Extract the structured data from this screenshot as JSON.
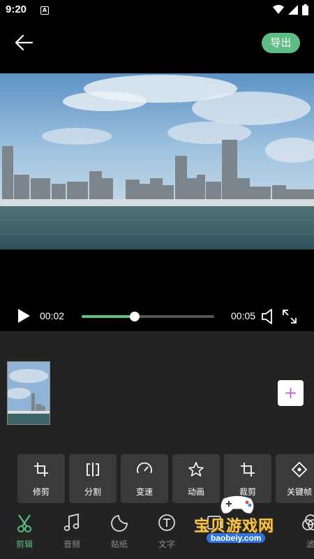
{
  "status_bar": {
    "time": "9:20",
    "notification_icon": "A",
    "icons": [
      "wifi-icon",
      "signal-icon",
      "battery-icon"
    ]
  },
  "header": {
    "back_icon": "arrow-left-icon",
    "export_label": "导出"
  },
  "player": {
    "current_time": "00:02",
    "total_time": "00:05",
    "progress_fraction": 0.4,
    "accent_color": "#5dbd84"
  },
  "tools": [
    {
      "label": "修剪",
      "icon": "trim-icon"
    },
    {
      "label": "分割",
      "icon": "split-icon"
    },
    {
      "label": "变速",
      "icon": "speed-gauge-icon"
    },
    {
      "label": "动画",
      "icon": "star-icon"
    },
    {
      "label": "裁剪",
      "icon": "crop-icon"
    },
    {
      "label": "关键帧",
      "icon": "keyframe-diamond-icon"
    }
  ],
  "nav": [
    {
      "label": "剪辑",
      "icon": "scissors-icon",
      "active": true
    },
    {
      "label": "音频",
      "icon": "music-note-icon",
      "active": false
    },
    {
      "label": "贴纸",
      "icon": "sticker-icon",
      "active": false
    },
    {
      "label": "文字",
      "icon": "text-icon",
      "active": false
    },
    {
      "label": "",
      "icon": "",
      "active": false
    },
    {
      "label": "滤",
      "icon": "filter-icon",
      "active": false
    }
  ],
  "watermark": {
    "title": "宝贝游戏网",
    "url": "baobeiy.com"
  }
}
